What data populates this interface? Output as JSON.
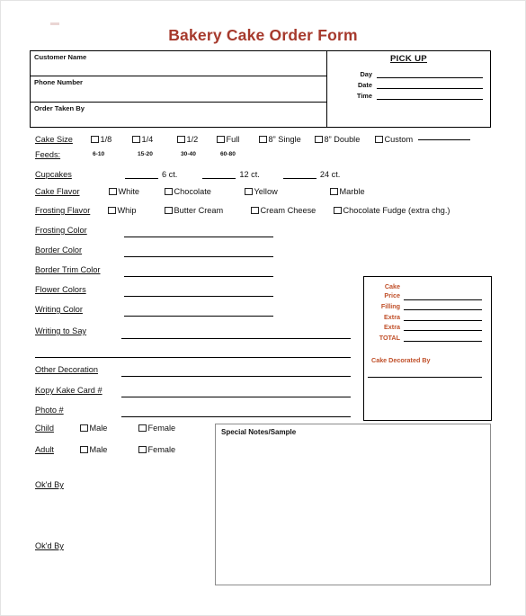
{
  "form": {
    "title": "Bakery Cake Order Form",
    "header": {
      "fields": [
        {
          "label": "Customer Name"
        },
        {
          "label": "Phone Number"
        },
        {
          "label": "Order Taken By"
        }
      ],
      "pickup": {
        "title": "PICK UP",
        "rows": [
          "Day",
          "Date",
          "Time"
        ]
      }
    },
    "cake_size": {
      "label": "Cake Size",
      "feeds_label": "Feeds:",
      "options": [
        {
          "label": "1/8",
          "feeds": "6-10"
        },
        {
          "label": "1/4",
          "feeds": "15-20"
        },
        {
          "label": "1/2",
          "feeds": "30-40"
        },
        {
          "label": "Full",
          "feeds": "60-80"
        },
        {
          "label": "8” Single",
          "feeds": ""
        },
        {
          "label": "8” Double",
          "feeds": ""
        },
        {
          "label": "Custom",
          "feeds": ""
        }
      ]
    },
    "cupcakes": {
      "label": "Cupcakes",
      "counts": [
        "6 ct.",
        "12 ct.",
        "24 ct."
      ]
    },
    "cake_flavor": {
      "label": "Cake Flavor",
      "options": [
        "White",
        "Chocolate",
        "Yellow",
        "Marble"
      ]
    },
    "frosting_flavor": {
      "label": "Frosting Flavor",
      "options": [
        "Whip",
        "Butter Cream",
        "Cream Cheese",
        "Chocolate Fudge (extra chg.)"
      ]
    },
    "color_lines": [
      "Frosting Color",
      "Border Color",
      "Border Trim Color",
      "Flower Colors",
      "Writing Color",
      "Writing to Say"
    ],
    "detail_lines": [
      "Other Decoration",
      "Kopy Kake Card #",
      "Photo #"
    ],
    "audience": {
      "rows": [
        "Child",
        "Adult"
      ],
      "options": [
        "Male",
        "Female"
      ]
    },
    "okd_by": [
      "Ok'd By",
      "Ok'd By"
    ],
    "price_box": {
      "rows": [
        "Cake Price",
        "Filling",
        "Extra",
        "Extra",
        "TOTAL"
      ],
      "cake_label_line1": "Cake",
      "cake_label_line2": "Price",
      "decorated_by": "Cake Decorated By"
    },
    "notes": {
      "label": "Special Notes/Sample"
    }
  },
  "colors": {
    "title": "#a6392c",
    "price_label": "#c0502a",
    "rule": "#000000",
    "notes_border": "#8c8c8c"
  }
}
